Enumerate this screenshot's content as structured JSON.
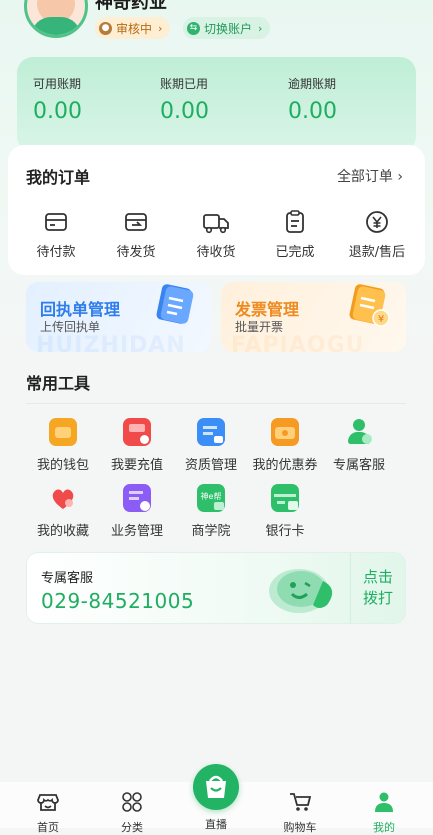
{
  "header": {
    "company_name": "神奇药业",
    "status_label": "审核中",
    "switch_label": "切换账户"
  },
  "account": {
    "items": [
      {
        "label": "可用账期",
        "value": "0.00"
      },
      {
        "label": "账期已用",
        "value": "0.00"
      },
      {
        "label": "逾期账期",
        "value": "0.00"
      }
    ]
  },
  "orders": {
    "title": "我的订单",
    "all_label": "全部订单",
    "items": [
      {
        "label": "待付款",
        "icon": "wallet-card-icon"
      },
      {
        "label": "待发货",
        "icon": "box-send-icon"
      },
      {
        "label": "待收货",
        "icon": "truck-icon"
      },
      {
        "label": "已完成",
        "icon": "clipboard-check-icon"
      },
      {
        "label": "退款/售后",
        "icon": "yuan-refund-icon"
      }
    ]
  },
  "promos": {
    "receipt": {
      "title": "回执单管理",
      "subtitle": "上传回执单",
      "watermark": "HUIZHIDAN"
    },
    "invoice": {
      "title": "发票管理",
      "subtitle": "批量开票",
      "watermark": "FAPIAOGU"
    }
  },
  "tools": {
    "title": "常用工具",
    "items": [
      {
        "label": "我的钱包",
        "icon": "wallet-icon",
        "color": "#f5a623"
      },
      {
        "label": "我要充值",
        "icon": "recharge-icon",
        "color": "#f04a4a"
      },
      {
        "label": "资质管理",
        "icon": "certificate-icon",
        "color": "#3a8ef6"
      },
      {
        "label": "我的优惠券",
        "icon": "coupon-icon",
        "color": "#f59a23"
      },
      {
        "label": "专属客服",
        "icon": "agent-icon",
        "color": "#2fbf6a"
      },
      {
        "label": "我的收藏",
        "icon": "heart-icon",
        "color": "#f04a4a"
      },
      {
        "label": "业务管理",
        "icon": "business-icon",
        "color": "#8b5cf6"
      },
      {
        "label": "商学院",
        "icon": "academy-icon",
        "color": "#2fbf6a",
        "badge": "神e帮"
      },
      {
        "label": "银行卡",
        "icon": "bank-card-icon",
        "color": "#2fbf6a"
      }
    ]
  },
  "service": {
    "title": "专属客服",
    "phone": "029-84521005",
    "call_line1": "点击",
    "call_line2": "拨打"
  },
  "tabbar": {
    "home": "首页",
    "category": "分类",
    "live": "直播",
    "cart": "购物车",
    "mine": "我的"
  },
  "colors": {
    "accent": "#1fae60",
    "receipt": "#2e7de9",
    "invoice": "#ee8a1e"
  }
}
